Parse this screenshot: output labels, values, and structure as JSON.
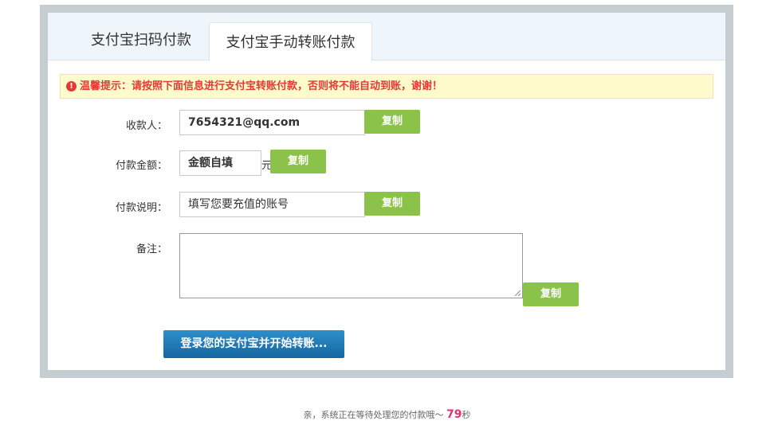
{
  "tabs": [
    {
      "label": "支付宝扫码付款"
    },
    {
      "label": "支付宝手动转账付款"
    }
  ],
  "notice": {
    "icon": "exclamation-icon",
    "text": "温馨提示：请按照下面信息进行支付宝转账付款，否则将不能自动到账，谢谢！"
  },
  "form": {
    "payee_label": "收款人：",
    "payee_value": "7654321@qq.com",
    "amount_label": "付款金额：",
    "amount_value": "金额自填",
    "amount_unit": "元",
    "desc_label": "付款说明：",
    "desc_value": "填写您要充值的账号",
    "remark_label": "备注：",
    "remark_value": "",
    "copy_label": "复制"
  },
  "login_button": "登录您的支付宝并开始转账...",
  "footer": {
    "prefix": "亲，系统正在等待处理您的付款哦～",
    "countdown": "79",
    "suffix": "秒"
  },
  "colors": {
    "accent_green": "#8bc34a",
    "accent_blue": "#1e7ab8",
    "notice_red": "#e23b36",
    "countdown_pink": "#e5306a"
  }
}
